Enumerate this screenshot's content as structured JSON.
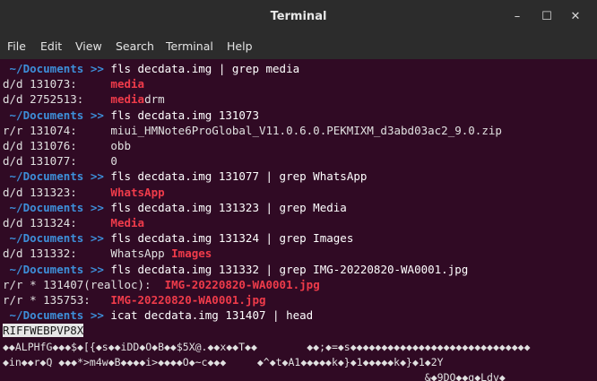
{
  "window": {
    "title": "Terminal",
    "min_glyph": "–",
    "max_glyph": "☐",
    "close_glyph": "✕"
  },
  "menu": [
    "File",
    "Edit",
    "View",
    "Search",
    "Terminal",
    "Help"
  ],
  "prompt": {
    "path": " ~/Documents",
    "sep": " >>"
  },
  "lines": [
    {
      "kind": "prompt",
      "cmd": " fls decdata.img | grep media"
    },
    {
      "kind": "out",
      "pre": "d/d 131073:     ",
      "hl": "media",
      "post": ""
    },
    {
      "kind": "out",
      "pre": "d/d 2752513:    ",
      "hl": "media",
      "post": "drm"
    },
    {
      "kind": "prompt",
      "cmd": " fls decdata.img 131073"
    },
    {
      "kind": "out",
      "pre": "r/r 131074:     miui_HMNote6ProGlobal_V11.0.6.0.PEKMIXM_d3abd03ac2_9.0.zip",
      "hl": "",
      "post": ""
    },
    {
      "kind": "out",
      "pre": "d/d 131076:     obb",
      "hl": "",
      "post": ""
    },
    {
      "kind": "out",
      "pre": "d/d 131077:     0",
      "hl": "",
      "post": ""
    },
    {
      "kind": "prompt",
      "cmd": " fls decdata.img 131077 | grep WhatsApp"
    },
    {
      "kind": "out",
      "pre": "d/d 131323:     ",
      "hl": "WhatsApp",
      "post": ""
    },
    {
      "kind": "prompt",
      "cmd": " fls decdata.img 131323 | grep Media"
    },
    {
      "kind": "out",
      "pre": "d/d 131324:     ",
      "hl": "Media",
      "post": ""
    },
    {
      "kind": "prompt",
      "cmd": " fls decdata.img 131324 | grep Images"
    },
    {
      "kind": "out",
      "pre": "d/d 131332:     WhatsApp ",
      "hl": "Images",
      "post": ""
    },
    {
      "kind": "prompt",
      "cmd": " fls decdata.img 131332 | grep IMG-20220820-WA0001.jpg"
    },
    {
      "kind": "out",
      "pre": "r/r * 131407(realloc):  ",
      "hl": "IMG-20220820-WA0001.jpg",
      "post": ""
    },
    {
      "kind": "out",
      "pre": "r/r * 135753:   ",
      "hl": "IMG-20220820-WA0001.jpg",
      "post": ""
    },
    {
      "kind": "prompt",
      "cmd": " icat decdata.img 131407 | head"
    },
    {
      "kind": "sel",
      "pre": "RIFFWEBPVP8X"
    },
    {
      "kind": "bin",
      "pre": "◆◆ALPHfG◆◆◆$◆[{◆s◆◆iDD◆O◆B◆◆$5X@.◆◆x◆◆T◆◆        ◆◆;◆=◆s◆◆◆◆◆◆◆◆◆◆◆◆◆◆◆◆◆◆◆◆◆◆◆◆◆◆◆◆◆"
    },
    {
      "kind": "bin",
      "pre": "◆in◆◆r◆Q ◆◆◆*>m4w◆B◆◆◆◆i>◆◆◆◆O◆~c◆◆◆     ◆^◆t◆A1◆◆◆◆◆k◆}◆1◆◆◆◆◆k◆}◆1◆2Y"
    },
    {
      "kind": "bin",
      "pre": "                                                                    &◆9DO◆◆g◆Ldv◆"
    }
  ]
}
